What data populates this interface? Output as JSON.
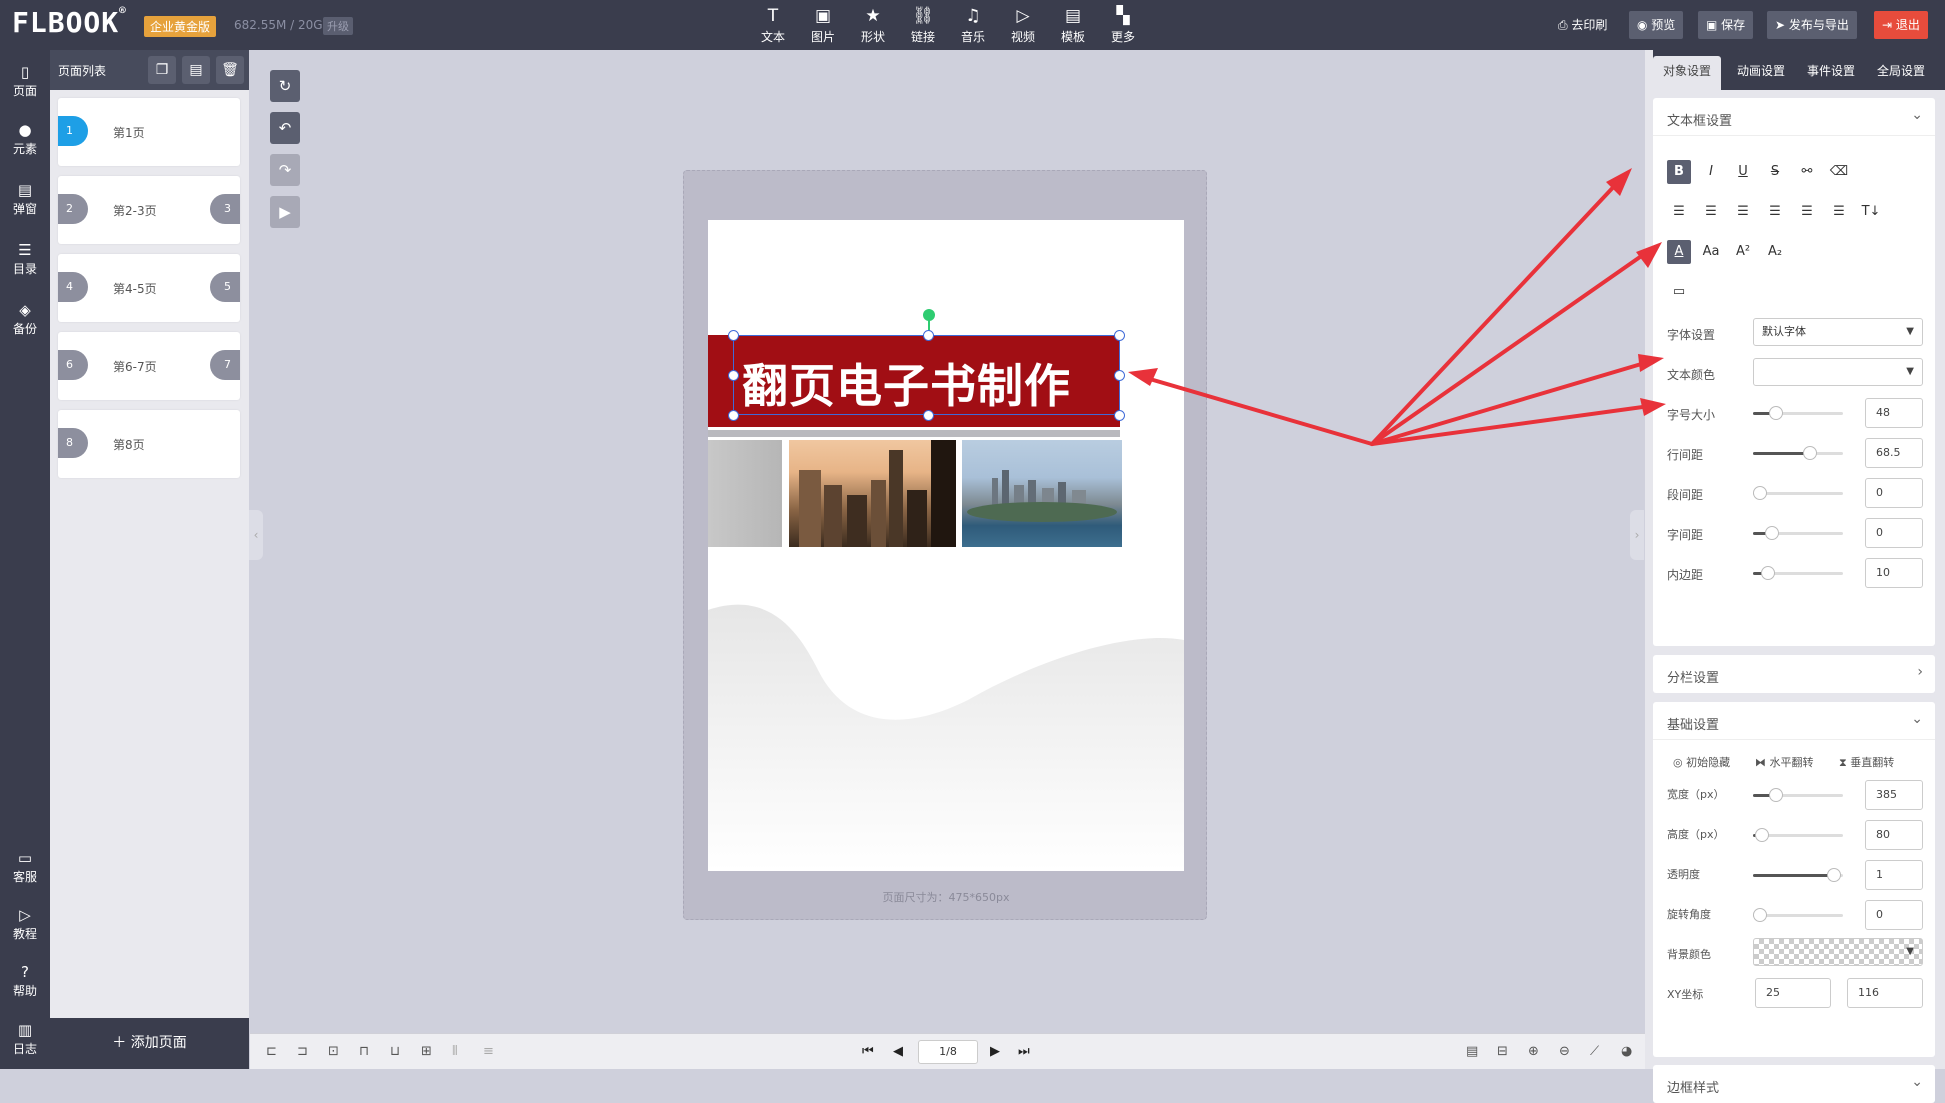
{
  "topbar": {
    "logo": "FLBOOK",
    "logo_mark": "®",
    "edition": "企业黄金版",
    "storage": "682.55M / 20G",
    "upgrade": "升级",
    "tools": [
      {
        "label": "文本",
        "icon": "T"
      },
      {
        "label": "图片",
        "icon": "▣"
      },
      {
        "label": "形状",
        "icon": "★"
      },
      {
        "label": "链接",
        "icon": "⛓"
      },
      {
        "label": "音乐",
        "icon": "♫"
      },
      {
        "label": "视频",
        "icon": "▷"
      },
      {
        "label": "模板",
        "icon": "▤"
      },
      {
        "label": "更多",
        "icon": "▚"
      }
    ],
    "print": "去印刷",
    "preview": "预览",
    "save": "保存",
    "publish": "发布与导出",
    "exit": "退出"
  },
  "rail": [
    {
      "label": "页面",
      "icon": "▯"
    },
    {
      "label": "元素",
      "icon": "●"
    },
    {
      "label": "弹窗",
      "icon": "▤"
    },
    {
      "label": "目录",
      "icon": "☰"
    },
    {
      "label": "备份",
      "icon": "◈"
    },
    {
      "label": "客服",
      "icon": "▭"
    },
    {
      "label": "教程",
      "icon": "▷"
    },
    {
      "label": "帮助",
      "icon": "?"
    },
    {
      "label": "日志",
      "icon": "▥"
    }
  ],
  "pagelist": {
    "title": "页面列表",
    "add": "添加页面",
    "pages": [
      {
        "label": "第1页",
        "left": "1",
        "right": ""
      },
      {
        "label": "第2-3页",
        "left": "2",
        "right": "3"
      },
      {
        "label": "第4-5页",
        "left": "4",
        "right": "5"
      },
      {
        "label": "第6-7页",
        "left": "6",
        "right": "7"
      },
      {
        "label": "第8页",
        "left": "8",
        "right": ""
      }
    ]
  },
  "canvas": {
    "title_text": "翻页电子书制作",
    "size_info": "页面尺寸为：475*650px",
    "page_indicator": "1/8"
  },
  "panel": {
    "tabs": [
      "对象设置",
      "动画设置",
      "事件设置",
      "全局设置"
    ],
    "textbox": {
      "title": "文本框设置",
      "font_label": "字体设置",
      "font_value": "默认字体",
      "color_label": "文本颜色",
      "size_label": "字号大小",
      "size_value": "48",
      "lineheight_label": "行间距",
      "lineheight_value": "68.5",
      "para_label": "段间距",
      "para_value": "0",
      "letter_label": "字间距",
      "letter_value": "0",
      "padding_label": "内边距",
      "padding_value": "10"
    },
    "columns": {
      "title": "分栏设置"
    },
    "basic": {
      "title": "基础设置",
      "hide": "初始隐藏",
      "hflip": "水平翻转",
      "vflip": "垂直翻转",
      "width_label": "宽度（px）",
      "width_value": "385",
      "height_label": "高度（px）",
      "height_value": "80",
      "opacity_label": "透明度",
      "opacity_value": "1",
      "rotate_label": "旋转角度",
      "rotate_value": "0",
      "bg_label": "背景颜色",
      "xy_label": "XY坐标",
      "x_value": "25",
      "y_value": "116"
    },
    "border": {
      "title": "边框样式"
    }
  },
  "colors": {
    "dark": "#3a3d4d",
    "accent_blue": "#1e9fe6",
    "title_red": "#a10e14",
    "exit_red": "#e74c3c",
    "edition_gold": "#e6a23c",
    "arrow_red": "#e8323a"
  }
}
